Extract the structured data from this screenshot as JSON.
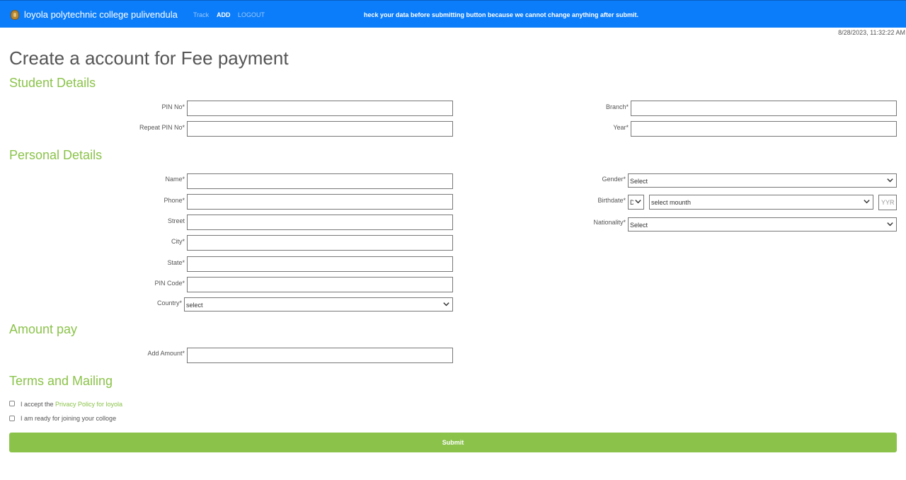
{
  "navbar": {
    "brand": "loyola polytechnic college pulivendula",
    "links": [
      {
        "label": "Track"
      },
      {
        "label": "ADD"
      },
      {
        "label": "LOGOUT"
      }
    ],
    "notice": "heck your data before submitting button because we cannot change anything after submit.",
    "color": "#0b7dfa"
  },
  "datetime": "8/28/2023, 11:32:22 AM",
  "page_title": "Create a account for Fee payment",
  "accent_color": "#8bc34a",
  "student_details": {
    "title": "Student Details",
    "pin_label": "PIN No*",
    "repeat_pin_label": "Repeat PIN No*",
    "branch_label": "Branch*",
    "year_label": "Year*"
  },
  "personal_details": {
    "title": "Personal Details",
    "name_label": "Name*",
    "phone_label": "Phone*",
    "street_label": "Street",
    "city_label": "City*",
    "state_label": "State*",
    "pincode_label": "PIN Code*",
    "country_label": "Country*",
    "country_value": "select",
    "gender_label": "Gender*",
    "gender_value": "Select",
    "birthdate_label": "Birthdate*",
    "birth_day_value": "D",
    "birth_month_value": "select mounth",
    "birth_year_placeholder": "YYR",
    "nationality_label": "Nationality*",
    "nationality_value": "Select"
  },
  "amount": {
    "title": "Amount pay",
    "label": "Add Amount*"
  },
  "terms": {
    "title": "Terms and Mailing",
    "accept_prefix": "I accept the ",
    "privacy_link": "Privacy Policy for loyola",
    "ready_label": "I am ready for joining your colloge"
  },
  "submit_label": "Submit"
}
